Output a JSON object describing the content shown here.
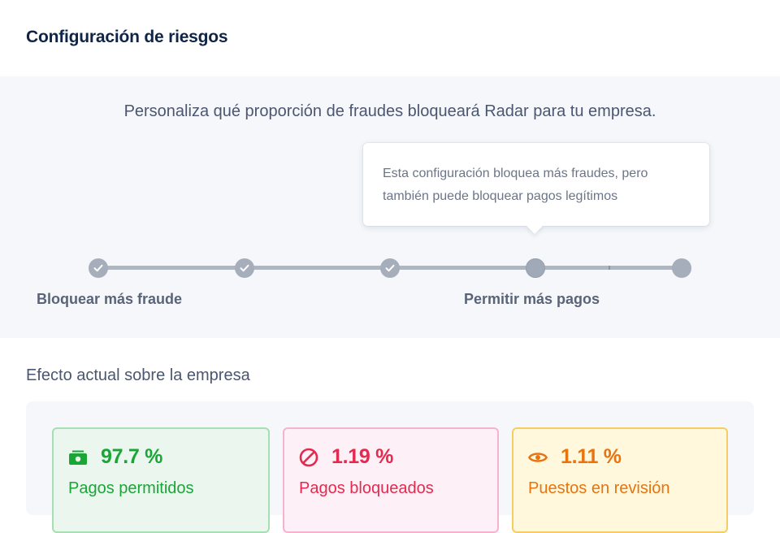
{
  "header": {
    "title": "Configuración de riesgos"
  },
  "risk_settings": {
    "description": "Personaliza qué proporción de fraudes bloqueará Radar para tu empresa.",
    "tooltip": "Esta configuración bloquea más fraudes, pero también puede bloquear pagos legítimos",
    "slider": {
      "steps": 5,
      "selected_step": 4,
      "completed_steps": 3,
      "label_left": "Bloquear más fraude",
      "label_right": "Permitir más pagos"
    }
  },
  "impact": {
    "title": "Efecto actual sobre la empresa",
    "cards": [
      {
        "value": "97.7 %",
        "label": "Pagos permitidos",
        "icon": "cash-icon",
        "color": "#1aa637"
      },
      {
        "value": "1.19 %",
        "label": "Pagos bloqueados",
        "icon": "blocked-icon",
        "color": "#e5294f"
      },
      {
        "value": "1.11 %",
        "label": "Puestos en revisión",
        "icon": "eye-icon",
        "color": "#e8730f"
      }
    ]
  }
}
